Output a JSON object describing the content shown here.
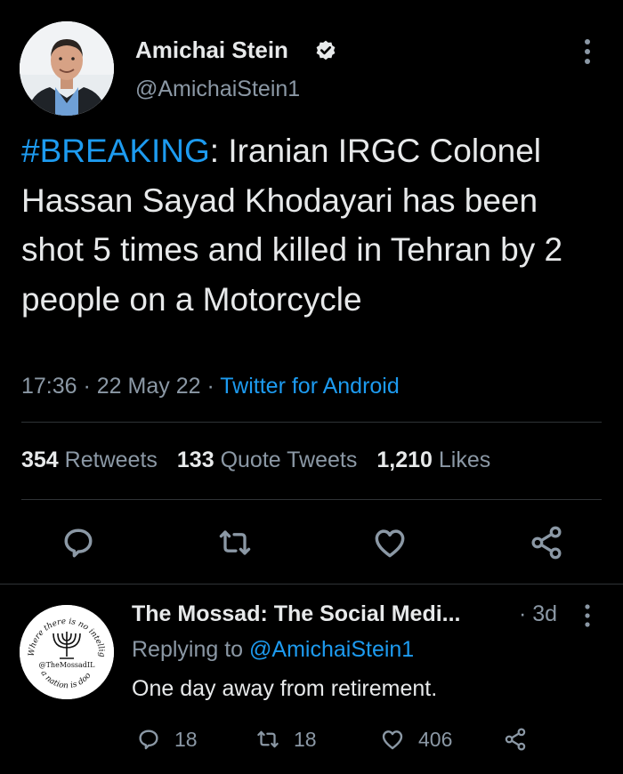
{
  "tweet": {
    "author_name": "Amichai Stein",
    "handle": "@AmichaiStein1",
    "hashtag": "#BREAKING",
    "text_rest": ": Iranian IRGC Colonel Hassan Sayad Khodayari has been shot 5 times and killed in Tehran by 2 people on a Motorcycle",
    "time": "17:36 · 22 May 22 · ",
    "source": "Twitter for Android",
    "stats": {
      "retweets_count": "354",
      "retweets_label": "Retweets",
      "quotes_count": "133",
      "quotes_label": "Quote Tweets",
      "likes_count": "1,210",
      "likes_label": "Likes"
    },
    "icons": [
      "reply-icon",
      "retweet-icon",
      "like-icon",
      "share-icon",
      "more-icon",
      "verified-icon"
    ]
  },
  "reply": {
    "author_name": "The Mossad: The Social Medi...",
    "age": "· 3d",
    "replying_prefix": "Replying to ",
    "replying_mention": "@AmichaiStein1",
    "text": "One day away from retirement.",
    "replies": "18",
    "retweets": "18",
    "likes": "406",
    "avatar_text": {
      "top": "Where there is no intelligence",
      "middle": "@TheMossadIL",
      "bottom": "a nation is doomed"
    }
  },
  "colors": {
    "background": "#000000",
    "text": "#e7e9ea",
    "muted": "#8b98a5",
    "accent": "#1d9bf0",
    "divider": "#2f3336"
  }
}
